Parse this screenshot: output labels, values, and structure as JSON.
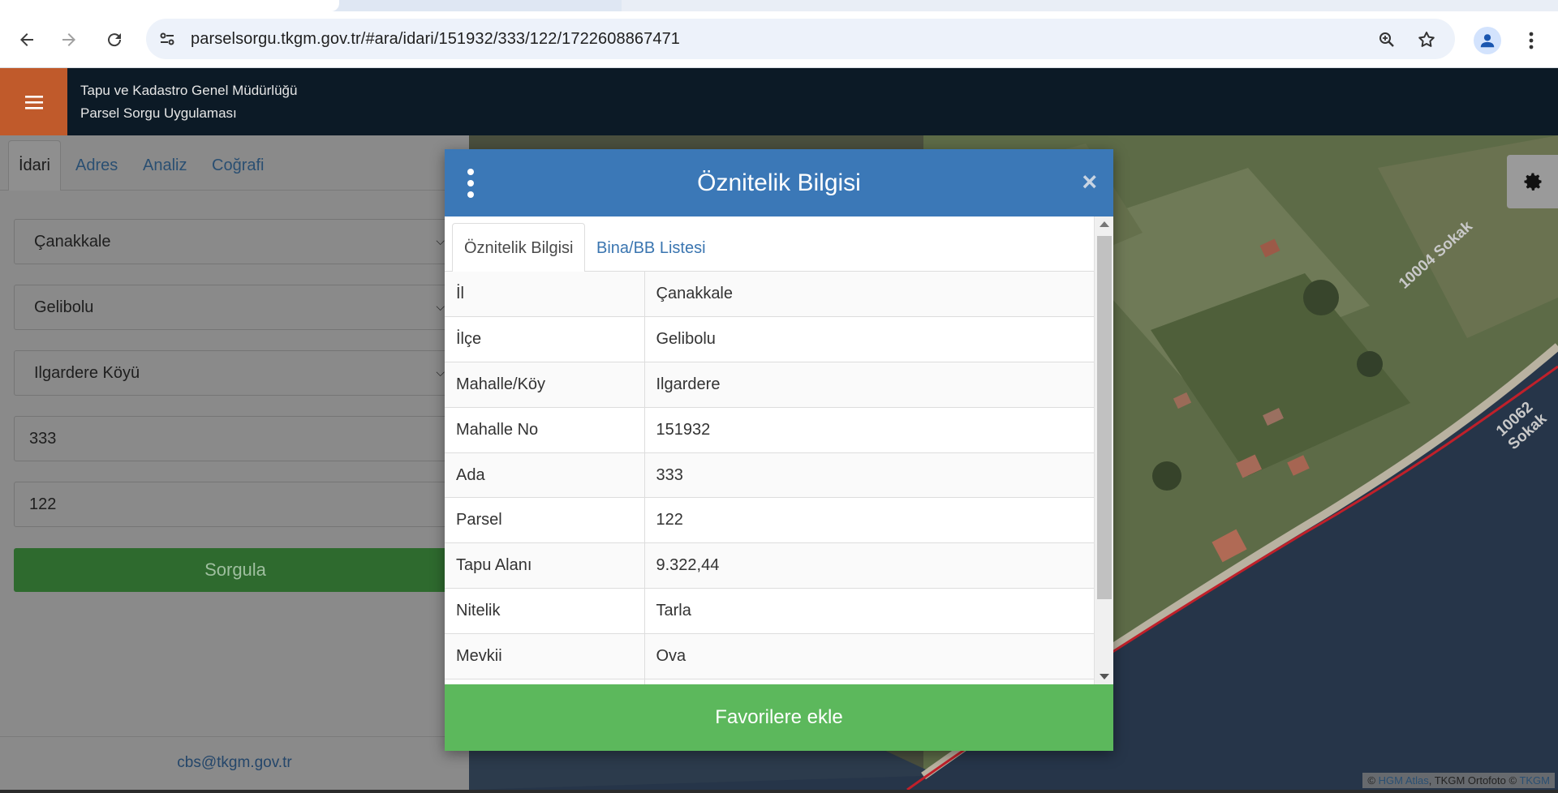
{
  "browser": {
    "url": "parselsorgu.tkgm.gov.tr/#ara/idari/151932/333/122/1722608867471",
    "icons": [
      "back-arrow-icon",
      "forward-arrow-icon",
      "reload-icon",
      "site-settings-icon",
      "zoom-icon",
      "bookmark-star-icon",
      "profile-icon",
      "more-vert-icon"
    ]
  },
  "app": {
    "org_name": "Tapu ve Kadastro Genel Müdürlüğü",
    "app_name": "Parsel Sorgu Uygulaması",
    "accent_color": "#c05a2b",
    "header_color": "#0c1a26"
  },
  "left_panel": {
    "tabs": [
      {
        "label": "İdari",
        "active": true
      },
      {
        "label": "Adres",
        "active": false
      },
      {
        "label": "Analiz",
        "active": false
      },
      {
        "label": "Coğrafi",
        "active": false
      }
    ],
    "province": "Çanakkale",
    "district": "Gelibolu",
    "neighborhood": "Ilgardere Köyü",
    "block_value": "333",
    "parcel_value": "122",
    "query_button": "Sorgula",
    "contact_email": "cbs@tkgm.gov.tr"
  },
  "map": {
    "road_labels": [
      "10004 Sokak",
      "10062 Sokak"
    ],
    "attribution": {
      "prefix": "©",
      "link1": "HGM Atlas",
      "middle": ", TKGM Ortofoto ©",
      "link2": "TKGM"
    }
  },
  "modal": {
    "title": "Öznitelik Bilgisi",
    "close_symbol": "×",
    "header_color": "#3b78b7",
    "tabs": [
      {
        "label": "Öznitelik Bilgisi",
        "active": true
      },
      {
        "label": "Bina/BB Listesi",
        "active": false
      }
    ],
    "rows": [
      {
        "key": "İl",
        "value": "Çanakkale"
      },
      {
        "key": "İlçe",
        "value": "Gelibolu"
      },
      {
        "key": "Mahalle/Köy",
        "value": "Ilgardere"
      },
      {
        "key": "Mahalle No",
        "value": "151932"
      },
      {
        "key": "Ada",
        "value": "333"
      },
      {
        "key": "Parsel",
        "value": "122"
      },
      {
        "key": "Tapu Alanı",
        "value": "9.322,44"
      },
      {
        "key": "Nitelik",
        "value": "Tarla"
      },
      {
        "key": "Mevkii",
        "value": "Ova"
      }
    ],
    "favorite_button": "Favorilere ekle",
    "favorite_color": "#5cb85c"
  }
}
